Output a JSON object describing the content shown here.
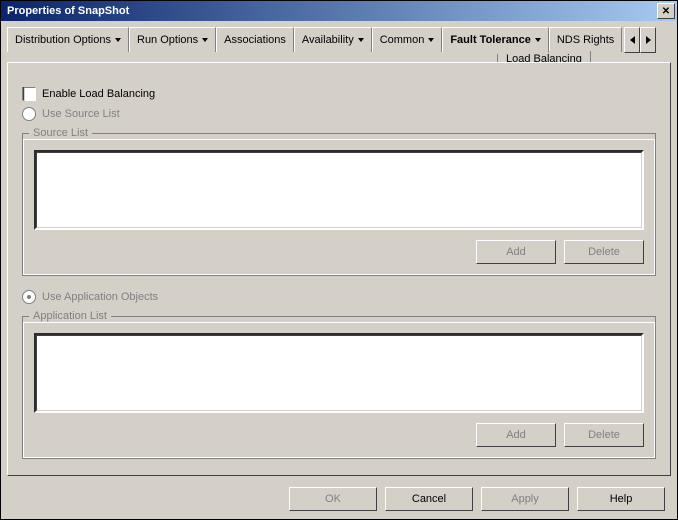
{
  "window": {
    "title": "Properties of SnapShot"
  },
  "tabs": {
    "items": [
      {
        "label": "Distribution Options"
      },
      {
        "label": "Run Options"
      },
      {
        "label": "Associations"
      },
      {
        "label": "Availability"
      },
      {
        "label": "Common"
      },
      {
        "label": "Fault Tolerance"
      },
      {
        "label": "NDS Rights"
      }
    ],
    "active_sub": "Load Balancing"
  },
  "body": {
    "enable_label": "Enable Load Balancing",
    "radio_source": "Use Source List",
    "radio_objects": "Use Application Objects",
    "source_group": "Source List",
    "app_group": "Application List",
    "add": "Add",
    "del": "Delete"
  },
  "footer": {
    "ok": "OK",
    "cancel": "Cancel",
    "apply": "Apply",
    "help": "Help"
  }
}
